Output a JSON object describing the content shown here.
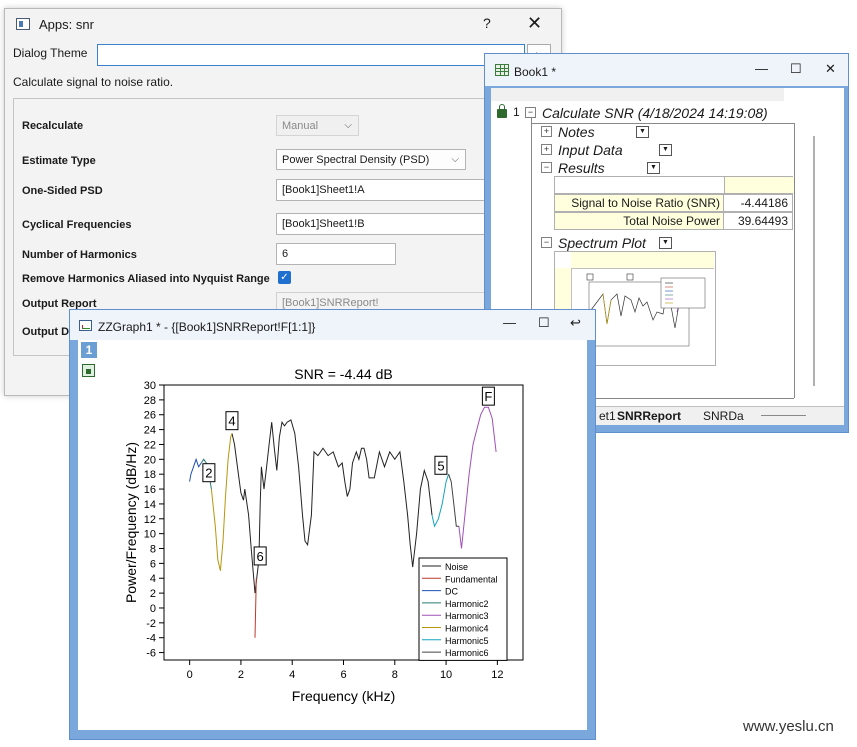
{
  "dialog": {
    "title": "Apps: snr",
    "help": "?",
    "close": "✕",
    "theme_label": "Dialog Theme",
    "theme_value": "",
    "description": "Calculate signal to noise ratio.",
    "rows": {
      "recalculate": {
        "label": "Recalculate",
        "value": "Manual"
      },
      "estimate_type": {
        "label": "Estimate Type",
        "value": "Power Spectral Density (PSD)"
      },
      "one_sided": {
        "label": "One-Sided PSD",
        "value": "[Book1]Sheet1!A"
      },
      "cyclical": {
        "label": "Cyclical Frequencies",
        "value": "[Book1]Sheet1!B"
      },
      "harmonics": {
        "label": "Number of Harmonics",
        "value": "6"
      },
      "remove_aliased": {
        "label": "Remove Harmonics Aliased into Nyquist Range",
        "checked": true,
        "check_glyph": "✓"
      },
      "output_report": {
        "label": "Output Report",
        "value": "[Book1]SNRReport!"
      },
      "output_d": {
        "label": "Output D"
      }
    }
  },
  "book": {
    "title": "Book1 *",
    "controls": [
      "—",
      "☐",
      "✕"
    ],
    "row_num": "1",
    "report_title": "Calculate SNR (4/18/2024 14:19:08)",
    "sections": {
      "notes": "Notes",
      "input_data": "Input Data",
      "results": "Results",
      "spectrum_plot": "Spectrum Plot"
    },
    "results_table": [
      {
        "label": "Signal to Noise Ratio (SNR)",
        "value": "-4.44186"
      },
      {
        "label": "Total Noise Power",
        "value": "39.64493"
      }
    ],
    "tabs": {
      "sheet1": "et1",
      "snrreport": "SNRReport",
      "snrdata": "SNRDa"
    }
  },
  "graph": {
    "title": "ZZGraph1 * - {[Book1]SNRReport!F[1:1]}",
    "controls": [
      "—",
      "☐",
      "↩"
    ],
    "layer": "1"
  },
  "watermark": "www.yeslu.cn",
  "chart_data": {
    "type": "line",
    "title": "SNR = -4.44 dB",
    "xlabel": "Frequency (kHz)",
    "ylabel": "Power/Frequency (dB/Hz)",
    "xlim": [
      -1,
      13
    ],
    "ylim": [
      -7,
      30
    ],
    "x_ticks": [
      0,
      2,
      4,
      6,
      8,
      10,
      12
    ],
    "y_ticks": [
      -6,
      -4,
      -2,
      0,
      2,
      4,
      6,
      8,
      10,
      12,
      14,
      16,
      18,
      20,
      22,
      24,
      26,
      28,
      30
    ],
    "legend_position": "bottom-right",
    "series": [
      {
        "name": "Noise",
        "color": "#222222",
        "points": [
          [
            1.65,
            23.5
          ],
          [
            1.75,
            22
          ],
          [
            1.9,
            18
          ],
          [
            2.0,
            15.5
          ],
          [
            2.1,
            14.5
          ],
          [
            2.15,
            16
          ],
          [
            2.3,
            12.5
          ],
          [
            2.4,
            8
          ],
          [
            2.55,
            2
          ],
          [
            2.7,
            6.5
          ],
          [
            2.75,
            14
          ],
          [
            2.8,
            19
          ],
          [
            2.9,
            16
          ],
          [
            3.0,
            19
          ],
          [
            3.1,
            22
          ],
          [
            3.2,
            25
          ],
          [
            3.3,
            21.5
          ],
          [
            3.4,
            18.5
          ],
          [
            3.5,
            23
          ],
          [
            3.6,
            25
          ],
          [
            3.7,
            24.5
          ],
          [
            3.8,
            25
          ],
          [
            3.95,
            25.3
          ],
          [
            4.1,
            23.5
          ],
          [
            4.25,
            19
          ],
          [
            4.4,
            12.5
          ],
          [
            4.5,
            9
          ],
          [
            4.6,
            8.5
          ],
          [
            4.75,
            12.5
          ],
          [
            4.85,
            21
          ],
          [
            5.0,
            20.5
          ],
          [
            5.2,
            21.5
          ],
          [
            5.4,
            20.5
          ],
          [
            5.6,
            21
          ],
          [
            5.8,
            19
          ],
          [
            5.95,
            19.5
          ],
          [
            6.05,
            17
          ],
          [
            6.15,
            15
          ],
          [
            6.25,
            16
          ],
          [
            6.35,
            19.5
          ],
          [
            6.5,
            21
          ],
          [
            6.6,
            20
          ],
          [
            6.7,
            21.5
          ],
          [
            6.8,
            21.5
          ],
          [
            6.9,
            20
          ],
          [
            7.0,
            17.5
          ],
          [
            7.2,
            17.5
          ],
          [
            7.4,
            21
          ],
          [
            7.6,
            19
          ],
          [
            7.8,
            21
          ],
          [
            8.0,
            20
          ],
          [
            8.2,
            21
          ],
          [
            8.35,
            17
          ],
          [
            8.5,
            12.5
          ],
          [
            8.6,
            8.5
          ],
          [
            8.7,
            5.5
          ],
          [
            8.85,
            10
          ],
          [
            9.0,
            16
          ],
          [
            9.15,
            18.5
          ],
          [
            9.3,
            17
          ],
          [
            9.45,
            12.5
          ]
        ]
      },
      {
        "name": "Fundamental",
        "color": "#c0392b",
        "points": [
          [
            2.55,
            -4
          ],
          [
            2.6,
            4
          ]
        ]
      },
      {
        "name": "DC",
        "color": "#1f4fb4",
        "points": [
          [
            0.0,
            17
          ],
          [
            0.05,
            18
          ],
          [
            0.15,
            19
          ],
          [
            0.25,
            20
          ],
          [
            0.35,
            19
          ],
          [
            0.45,
            19.5
          ]
        ]
      },
      {
        "name": "Harmonic2",
        "color": "#2a7a6e",
        "points": [
          [
            0.45,
            19.5
          ],
          [
            0.55,
            20
          ],
          [
            0.65,
            19.5
          ],
          [
            0.75,
            18
          ],
          [
            0.85,
            16
          ]
        ]
      },
      {
        "name": "Harmonic3",
        "color": "#a050b8",
        "points": [
          [
            10.5,
            11
          ],
          [
            10.6,
            8
          ],
          [
            10.75,
            13
          ],
          [
            10.9,
            18
          ],
          [
            11.05,
            22
          ],
          [
            11.2,
            24
          ],
          [
            11.35,
            26
          ],
          [
            11.5,
            27
          ],
          [
            11.65,
            27
          ],
          [
            11.8,
            25.5
          ],
          [
            11.95,
            21
          ]
        ]
      },
      {
        "name": "Harmonic4",
        "color": "#b8960c",
        "points": [
          [
            0.85,
            16
          ],
          [
            1.0,
            11
          ],
          [
            1.1,
            6.5
          ],
          [
            1.2,
            5
          ],
          [
            1.3,
            9
          ],
          [
            1.4,
            15
          ],
          [
            1.5,
            20
          ],
          [
            1.6,
            23
          ],
          [
            1.65,
            23.5
          ]
        ]
      },
      {
        "name": "Harmonic5",
        "color": "#12a3bd",
        "points": [
          [
            9.45,
            12.5
          ],
          [
            9.55,
            11
          ],
          [
            9.7,
            12
          ],
          [
            9.85,
            14
          ],
          [
            10.0,
            17
          ],
          [
            10.1,
            18
          ]
        ]
      },
      {
        "name": "Harmonic6",
        "color": "#444444",
        "points": [
          [
            10.1,
            18
          ],
          [
            10.2,
            17
          ],
          [
            10.3,
            14
          ],
          [
            10.4,
            11
          ],
          [
            10.5,
            11
          ]
        ]
      }
    ],
    "annotations": [
      {
        "text": "2",
        "x": 0.75,
        "y": 18.2
      },
      {
        "text": "4",
        "x": 1.65,
        "y": 25.2
      },
      {
        "text": "6",
        "x": 2.75,
        "y": 7.0
      },
      {
        "text": "5",
        "x": 9.8,
        "y": 19.2
      },
      {
        "text": "F",
        "x": 11.65,
        "y": 28.5
      }
    ]
  }
}
